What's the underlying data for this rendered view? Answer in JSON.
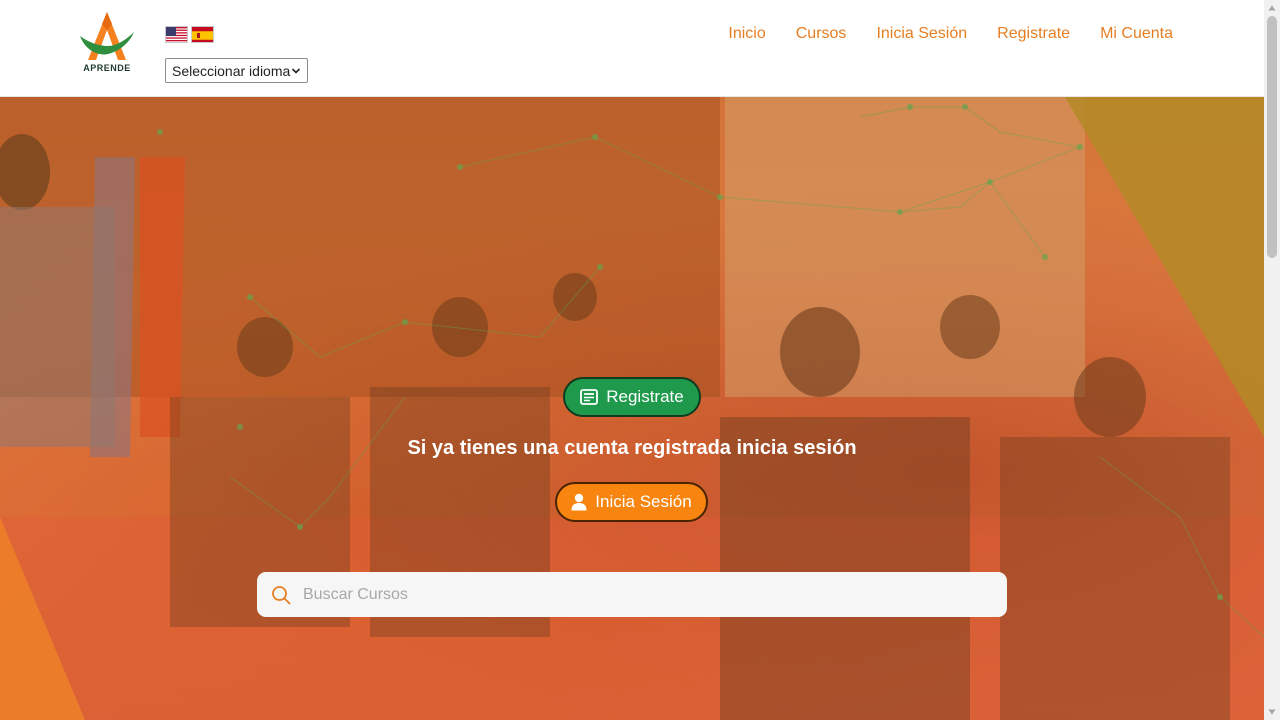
{
  "header": {
    "logo_text": "APRENDE",
    "language_select": {
      "selected": "Seleccionar idioma"
    },
    "flags": [
      "english-flag",
      "spanish-flag"
    ],
    "nav": [
      {
        "label": "Inicio"
      },
      {
        "label": "Cursos"
      },
      {
        "label": "Inicia Sesión"
      },
      {
        "label": "Registrate"
      },
      {
        "label": "Mi Cuenta"
      }
    ]
  },
  "hero": {
    "register_button": "Registrate",
    "message": "Si ya tienes una cuenta registrada inicia sesión",
    "login_button": "Inicia Sesión",
    "search": {
      "placeholder": "Buscar Cursos"
    }
  },
  "colors": {
    "accent_orange": "#e67e22",
    "register_green": "#1f9a4d",
    "login_orange": "#f7850f"
  },
  "icons": {
    "register_icon": "registration-card-icon",
    "login_icon": "user-icon",
    "search_icon": "search-icon"
  }
}
